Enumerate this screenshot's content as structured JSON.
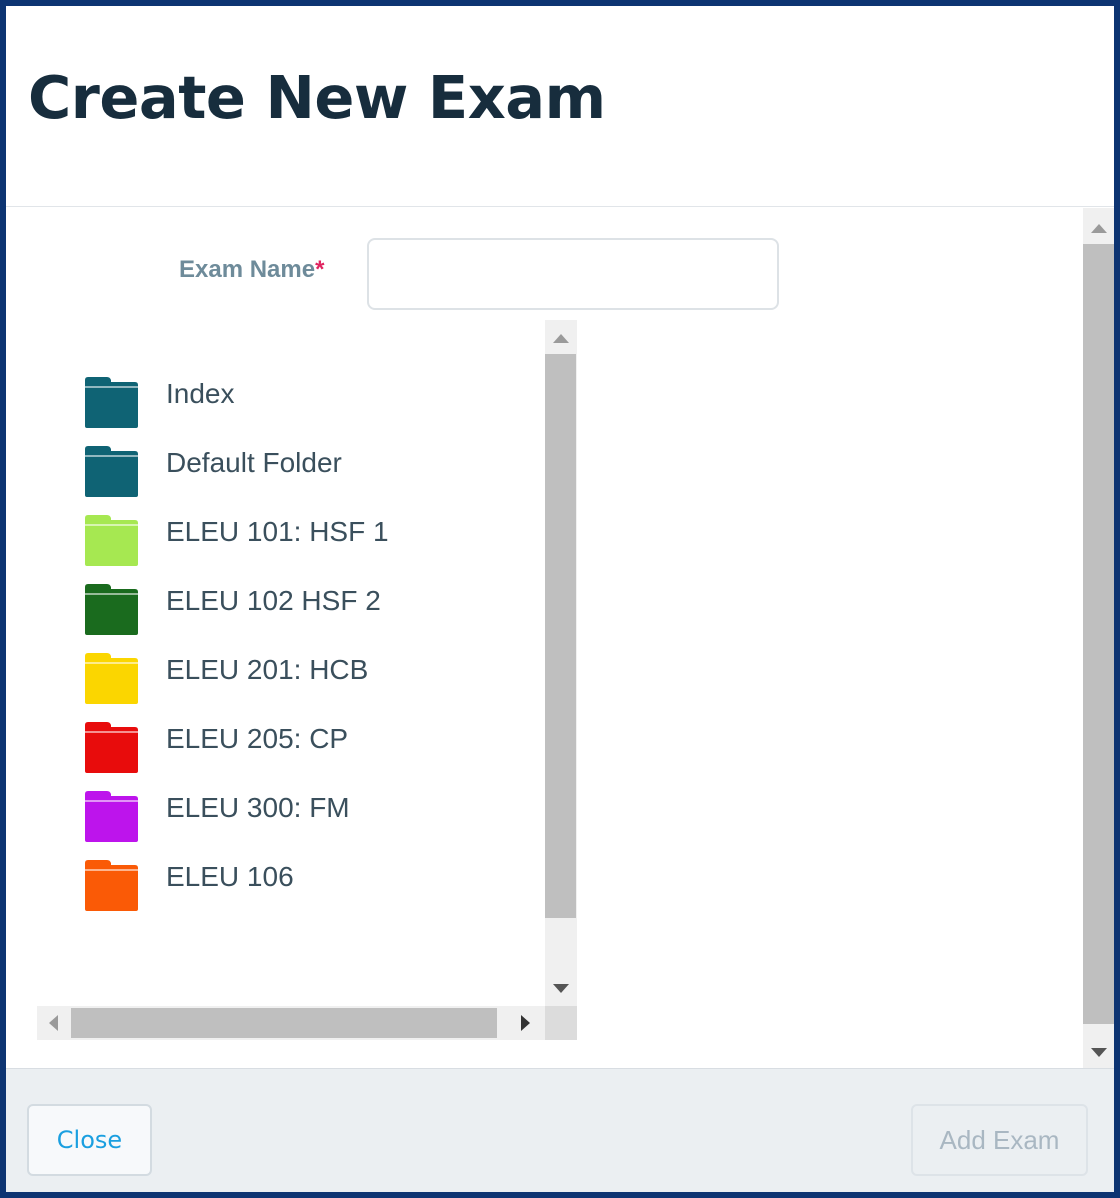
{
  "modal": {
    "title": "Create New Exam"
  },
  "form": {
    "exam_name_label": "Exam Name",
    "required_marker": "*",
    "exam_name_value": ""
  },
  "folders": [
    {
      "label": "Index",
      "color": "#0f6374"
    },
    {
      "label": "Default Folder",
      "color": "#0f6374"
    },
    {
      "label": "ELEU 101: HSF 1",
      "color": "#a6e851"
    },
    {
      "label": "ELEU 102 HSF 2",
      "color": "#1a6b1e"
    },
    {
      "label": "ELEU 201: HCB",
      "color": "#fbd600"
    },
    {
      "label": "ELEU 205: CP",
      "color": "#e80c0c"
    },
    {
      "label": "ELEU 300: FM",
      "color": "#bd14ec"
    },
    {
      "label": "ELEU 106",
      "color": "#fa5a06"
    }
  ],
  "footer": {
    "close_label": "Close",
    "add_label": "Add Exam"
  }
}
